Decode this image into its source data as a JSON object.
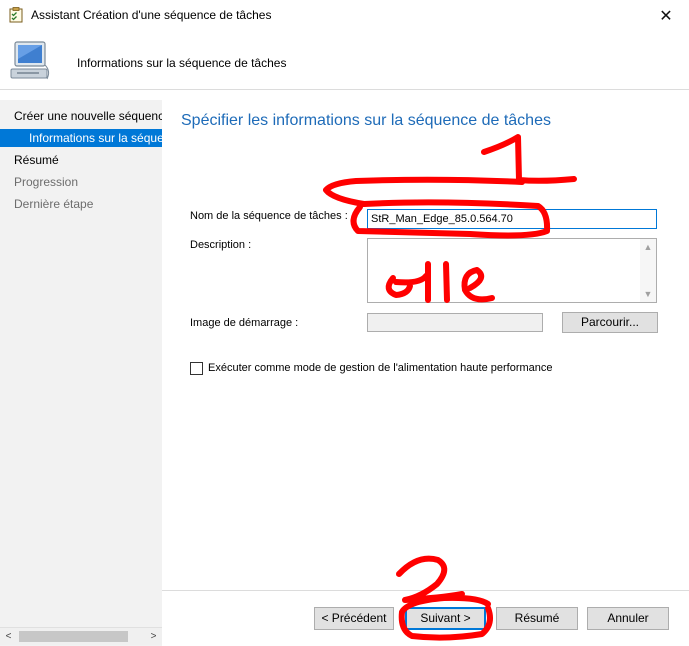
{
  "window": {
    "title": "Assistant Création d'une séquence de tâches",
    "close_glyph": "✕"
  },
  "header": {
    "title": "Informations sur la séquence de tâches"
  },
  "sidebar": {
    "items": [
      {
        "label": "Créer une nouvelle séquence de tâches"
      },
      {
        "label": "Informations sur la séquence de tâches"
      },
      {
        "label": "Résumé"
      },
      {
        "label": "Progression"
      },
      {
        "label": "Dernière étape"
      }
    ]
  },
  "main": {
    "title": "Spécifier les informations sur la séquence de tâches",
    "name_label": "Nom de la séquence de tâches :",
    "name_value": "StR_Man_Edge_85.0.564.70",
    "description_label": "Description :",
    "boot_image_label": "Image de démarrage :",
    "browse_button": "Parcourir...",
    "high_perf_checkbox": {
      "label": "Exécuter comme mode de gestion de l'alimentation haute performance",
      "checked": false
    }
  },
  "footer": {
    "previous_button": "< Précédent",
    "next_button": "Suivant >",
    "summary_button": "Résumé",
    "cancel_button": "Annuler"
  },
  "colors": {
    "accent": "#0078d7",
    "title_blue": "#1e6bb8",
    "annotation_red": "#ff0000",
    "sidebar_bg": "#f2f2f2"
  },
  "icons": {
    "app": "task-sequence-icon",
    "header": "computer-monitor-icon"
  }
}
